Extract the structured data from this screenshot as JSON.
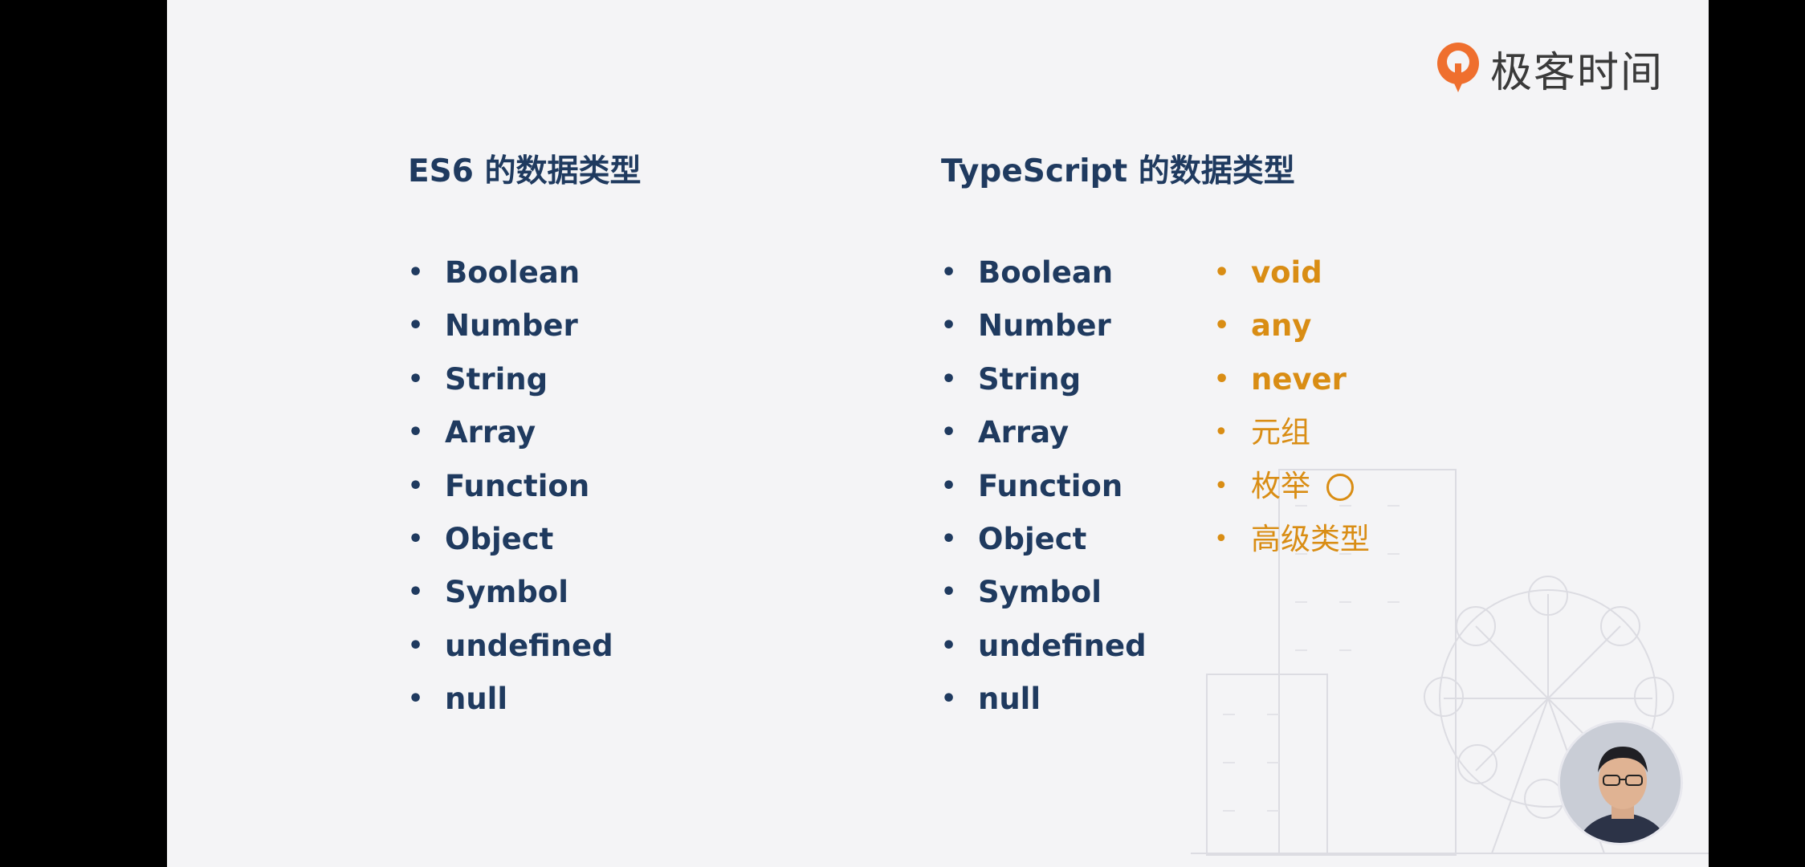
{
  "logo": {
    "text": "极客时间",
    "icon": "geekbang-logo-icon",
    "accent": "#ef6f2e"
  },
  "es6": {
    "title": "ES6 的数据类型",
    "items": [
      "Boolean",
      "Number",
      "String",
      "Array",
      "Function",
      "Object",
      "Symbol",
      "undefined",
      "null"
    ]
  },
  "ts": {
    "title": "TypeScript 的数据类型",
    "items": [
      "Boolean",
      "Number",
      "String",
      "Array",
      "Function",
      "Object",
      "Symbol",
      "undefined",
      "null"
    ],
    "extra": [
      "void",
      "any",
      "never",
      "元组",
      "枚举",
      "高级类型"
    ]
  },
  "colors": {
    "primary": "#1f3a5f",
    "accent": "#d98d14",
    "background": "#f4f4f6"
  },
  "presenter": {
    "icon": "presenter-avatar"
  }
}
